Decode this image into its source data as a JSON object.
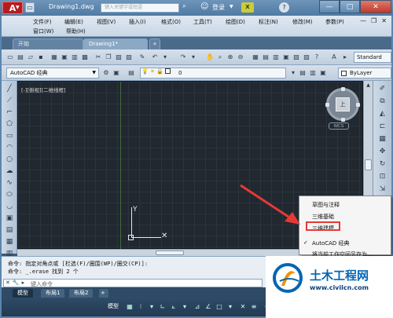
{
  "titlebar": {
    "logo_letter": "A",
    "document_title": "Drawing1.dwg",
    "search_placeholder": "键入关键字或短语",
    "signin_label": "登录",
    "exchange_label": "X",
    "help_label": "?",
    "minimize": "—",
    "maximize": "□",
    "close": "✕"
  },
  "menubar": {
    "items": [
      "文件(F)",
      "编辑(E)",
      "视图(V)",
      "插入(I)",
      "格式(O)",
      "工具(T)",
      "绘图(D)",
      "标注(N)",
      "修改(M)",
      "参数(P)",
      "窗口(W)",
      "帮助(H)"
    ],
    "ctrl_min": "—",
    "ctrl_restore": "❐",
    "ctrl_close": "✕"
  },
  "filetabs": {
    "tabs": [
      "开始",
      "Drawing1*"
    ],
    "add": "+"
  },
  "toolbar1": {
    "workspace_name": "Standard"
  },
  "toolbar2": {
    "workspace_combo": "AutoCAD 经典",
    "layer_value": "0",
    "color_value": "ByLayer"
  },
  "drawing": {
    "viewport_label": "[-][俯视][二维线框]",
    "ucs_y": "Y",
    "viewcube_face": "上",
    "wcs_label": "WCS"
  },
  "command": {
    "line1": "命令: 指定对角点或 [栏选(F)/圈围(WP)/圈交(CP)]:",
    "line2": "命令: _.erase 找到 2 个",
    "placeholder": "键入命令"
  },
  "layout_tabs": [
    "模型",
    "布局1",
    "布局2"
  ],
  "status": {
    "model_label": "模型"
  },
  "context_menu": {
    "items": [
      "草图与注释",
      "三维基础",
      "三维建模",
      "AutoCAD 经典",
      "将当前工作空间另存为..."
    ],
    "checked_index": 3,
    "highlighted_index": 2,
    "check_mark": "✓"
  },
  "watermark": {
    "title": "土木工程网",
    "url": "www.civilcn.com"
  },
  "colors": {
    "highlight_box": "#e53935",
    "arrow": "#e53935",
    "watermark_blue": "#0066b3"
  }
}
